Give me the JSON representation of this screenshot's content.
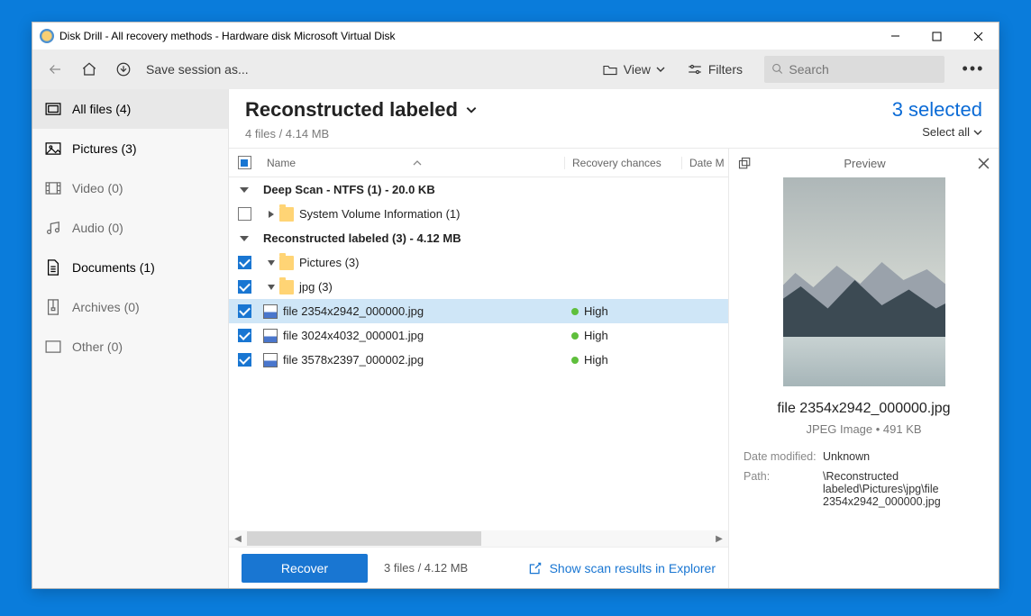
{
  "window": {
    "title": "Disk Drill - All recovery methods - Hardware disk Microsoft Virtual Disk"
  },
  "toolbar": {
    "save_session": "Save session as...",
    "view": "View",
    "filters": "Filters",
    "search_placeholder": "Search"
  },
  "sidebar": {
    "items": [
      {
        "label": "All files (4)",
        "icon": "allfiles"
      },
      {
        "label": "Pictures (3)",
        "icon": "pictures"
      },
      {
        "label": "Video (0)",
        "icon": "video"
      },
      {
        "label": "Audio (0)",
        "icon": "audio"
      },
      {
        "label": "Documents (1)",
        "icon": "documents"
      },
      {
        "label": "Archives (0)",
        "icon": "archives"
      },
      {
        "label": "Other (0)",
        "icon": "other"
      }
    ]
  },
  "header": {
    "title": "Reconstructed labeled",
    "subtitle": "4 files / 4.14 MB",
    "selected": "3 selected",
    "select_all": "Select all"
  },
  "columns": {
    "name": "Name",
    "recovery": "Recovery chances",
    "date": "Date M"
  },
  "rows": {
    "g1": "Deep Scan - NTFS (1) - 20.0 KB",
    "g1a": "System Volume Information (1)",
    "g2": "Reconstructed labeled (3) - 4.12 MB",
    "g2a": "Pictures (3)",
    "g2b": "jpg (3)",
    "f1": "file 2354x2942_000000.jpg",
    "f2": "file 3024x4032_000001.jpg",
    "f3": "file 3578x2397_000002.jpg",
    "high": "High"
  },
  "preview": {
    "title": "Preview",
    "filename": "file 2354x2942_000000.jpg",
    "meta": "JPEG Image • 491 KB",
    "date_label": "Date modified:",
    "date_value": "Unknown",
    "path_label": "Path:",
    "path_value": "\\Reconstructed labeled\\Pictures\\jpg\\file 2354x2942_000000.jpg"
  },
  "footer": {
    "recover": "Recover",
    "info": "3 files / 4.12 MB",
    "explorer": "Show scan results in Explorer"
  }
}
